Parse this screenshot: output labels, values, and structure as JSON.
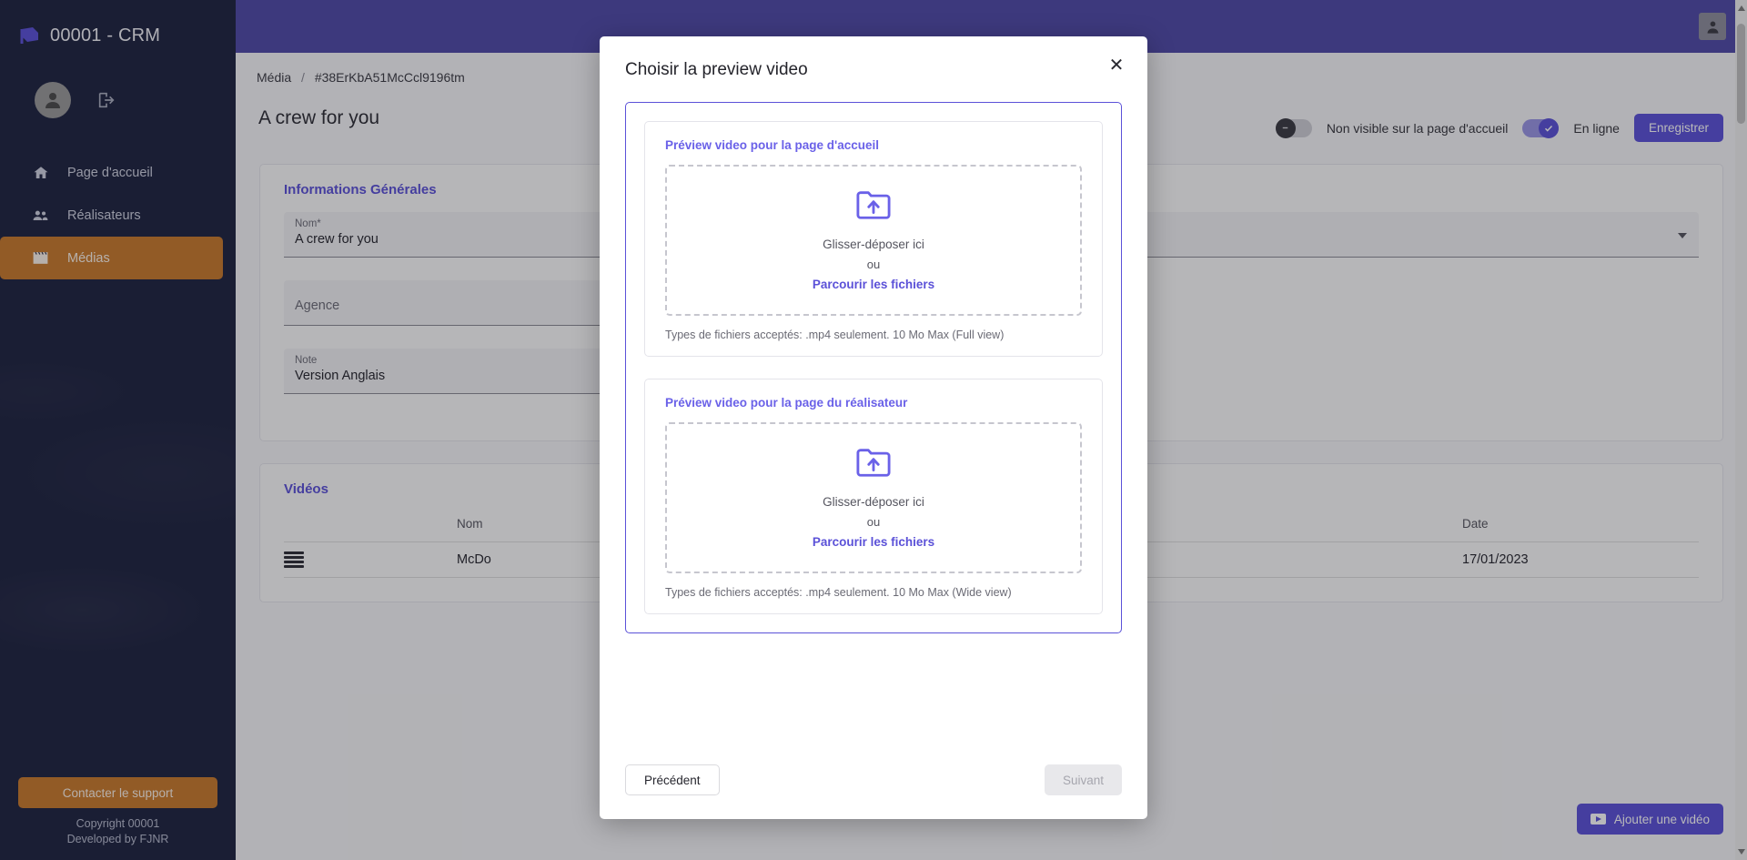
{
  "sidebar": {
    "brand": "00001 - CRM",
    "logo_icon": "flag-logo-icon",
    "avatar_icon": "user-avatar-icon",
    "logout_icon": "logout-icon",
    "items": [
      {
        "label": "Page d'accueil",
        "icon": "home-icon",
        "active": false
      },
      {
        "label": "Réalisateurs",
        "icon": "people-icon",
        "active": false
      },
      {
        "label": "Médias",
        "icon": "clapperboard-icon",
        "active": true
      }
    ],
    "support_label": "Contacter le support",
    "copyright_line1": "Copyright 00001",
    "copyright_line2": "Developed by FJNR"
  },
  "topbar": {
    "avatar_icon": "account-icon"
  },
  "page": {
    "breadcrumb": {
      "root": "Média",
      "separator": "/",
      "current": "#38ErKbA51McCcl9196tm"
    },
    "title": "A crew for you",
    "visibility_toggle_label": "Non visible sur la page d'accueil",
    "online_toggle_label": "En ligne",
    "save_label": "Enregistrer"
  },
  "general_card": {
    "title": "Informations Générales",
    "fields": [
      {
        "label": "Nom*",
        "value": "A crew for you",
        "placeholder": ""
      },
      {
        "label": "",
        "value": "",
        "placeholder": "Agence"
      },
      {
        "label": "Note",
        "value": "Version Anglais",
        "placeholder": ""
      }
    ],
    "right_select": {
      "label": "",
      "value": "",
      "caret": "chevron-down-icon"
    }
  },
  "videos_card": {
    "title": "Vidéos",
    "columns": [
      "",
      "",
      "Nom",
      "Date"
    ],
    "rows": [
      {
        "drag": "drag-handle-icon",
        "thumb": "video-thumbnail",
        "name": "McDo",
        "date": "17/01/2023"
      }
    ],
    "add_button": {
      "label": "Ajouter une vidéo",
      "icon": "video-play-icon"
    }
  },
  "modal": {
    "title": "Choisir la preview video",
    "close_icon": "close-icon",
    "cards": [
      {
        "title": "Préview video pour la page d'accueil",
        "upload_icon": "folder-upload-icon",
        "drop_text": "Glisser-déposer ici",
        "or_text": "ou",
        "browse_text": "Parcourir les fichiers",
        "filetypes": "Types de fichiers acceptés: .mp4 seulement. 10 Mo Max (Full view)"
      },
      {
        "title": "Préview video pour la page du réalisateur",
        "upload_icon": "folder-upload-icon",
        "drop_text": "Glisser-déposer ici",
        "or_text": "ou",
        "browse_text": "Parcourir les fichiers",
        "filetypes": "Types de fichiers acceptés: .mp4 seulement. 10 Mo Max (Wide view)"
      }
    ],
    "prev_label": "Précédent",
    "next_label": "Suivant"
  },
  "colors": {
    "sidebar_bg": "#1e2340",
    "accent_orange": "#c97a2c",
    "brand_purple": "#5b51d8",
    "topbar_purple": "#4f4aa8"
  }
}
